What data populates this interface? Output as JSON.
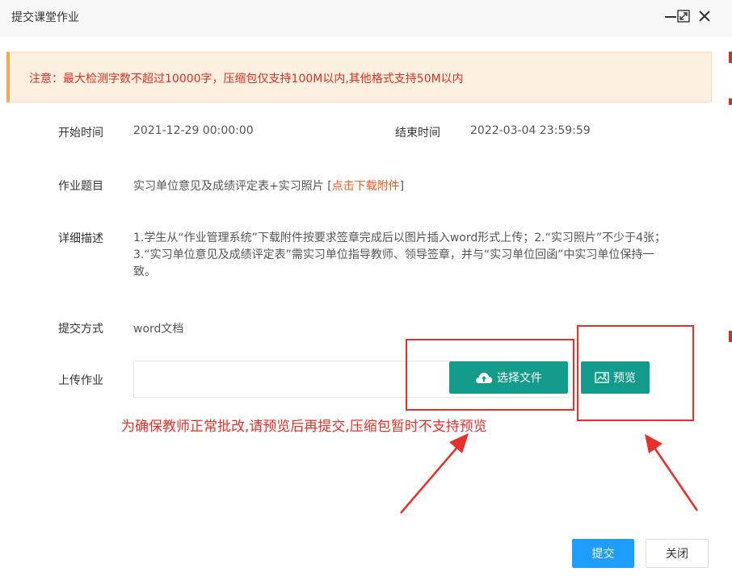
{
  "dialog": {
    "title": "提交课堂作业",
    "icons": {
      "minimize": "minimize-icon",
      "maximize": "maximize-icon",
      "close": "close-icon"
    }
  },
  "notice": {
    "text": "注意：最大检测字数不超过10000字，压缩包仅支持100M以内,其他格式支持50M以内"
  },
  "form": {
    "start_label": "开始时间",
    "start_value": "2021-12-29 00:00:00",
    "end_label": "结束时间",
    "end_value": "2022-03-04 23:59:59",
    "topic_label": "作业题目",
    "topic_value": "实习单位意见及成绩评定表+实习照片",
    "download_link_prefix": "[",
    "download_link": "点击下载附件",
    "download_link_suffix": "]",
    "desc_label": "详细描述",
    "desc_value": "1.学生从“作业管理系统”下载附件按要求签章完成后以图片插入word形式上传；2.“实习照片”不少于4张；3.“实习单位意见及成绩评定表”需实习单位指导教师、领导签章，并与“实习单位回函”中实习单位保持一致。",
    "method_label": "提交方式",
    "method_value": "word文档",
    "upload_label": "上传作业",
    "upload_value": "",
    "select_file_button": "选择文件",
    "select_file_icon": "cloud-upload-icon",
    "preview_button": "预览",
    "preview_icon": "image-icon"
  },
  "annotation": {
    "hint": "为确保教师正常批改,请预览后再提交,压缩包暂时不支持预览",
    "color": "#e8302a"
  },
  "footer": {
    "submit_button": "提交",
    "close_button": "关闭"
  },
  "colors": {
    "green": "#139b8c",
    "blue": "#1e9fff",
    "notice_bg": "#fdf0e0",
    "notice_text": "#e0301e"
  }
}
